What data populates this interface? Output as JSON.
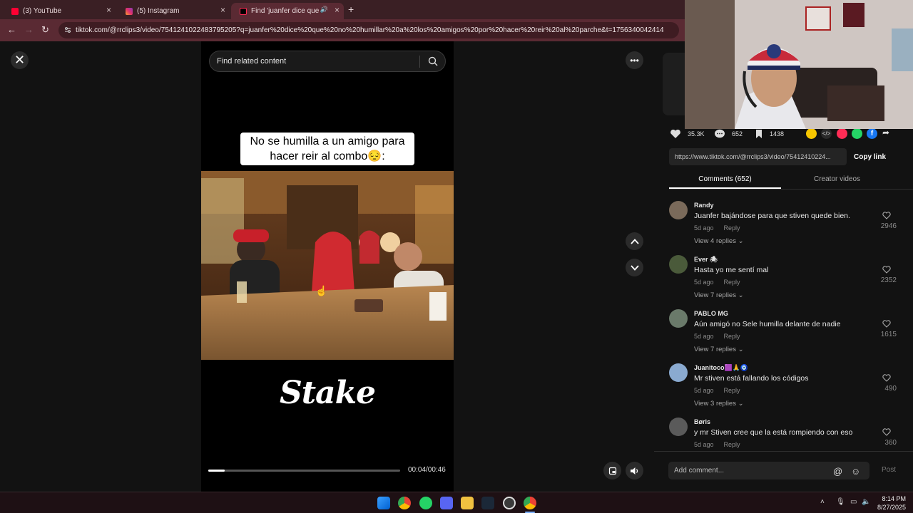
{
  "browser": {
    "tabs": [
      {
        "label": "(3) YouTube",
        "favicon_color": "#ff0033"
      },
      {
        "label": "(5) Instagram",
        "favicon_color": "#e1306c"
      },
      {
        "label": "Find 'juanfer dice que no h",
        "favicon_color": "#000000"
      }
    ],
    "new_tab": "+",
    "url": "tiktok.com/@rrclips3/video/7541241022483795205?q=juanfer%20dice%20que%20no%20humillar%20a%20los%20amigos%20por%20hacer%20reir%20al%20parche&t=1756340042414"
  },
  "video": {
    "search_placeholder": "Find related content",
    "caption": "No se humilla a un amigo para hacer reir al combo😔:",
    "watermark": "Stake",
    "time": "00:04/00:46",
    "progress": 0.087
  },
  "stats": {
    "likes": "35.3K",
    "comments": "652",
    "saves": "1438"
  },
  "share": {
    "link": "https://www.tiktok.com/@rrclips3/video/75412410224...",
    "copy_label": "Copy link"
  },
  "tabs": {
    "comments": "Comments (652)",
    "creator": "Creator videos"
  },
  "comments": [
    {
      "user": "Randy",
      "text": "Juanfer bajándose para que stiven quede bien.",
      "age": "5d ago",
      "reply": "Reply",
      "replies": "View 4 replies ⌄",
      "likes": "2946",
      "avatar_color": "#7a6a5a"
    },
    {
      "user": "Ever 🕷",
      "text": "Hasta yo me sentí mal",
      "age": "5d ago",
      "reply": "Reply",
      "replies": "View 7 replies ⌄",
      "likes": "2352",
      "avatar_color": "#4a5a3a"
    },
    {
      "user": "PABLO MG",
      "text": "Aún amigó no Sele humilla delante de nadie",
      "age": "5d ago",
      "reply": "Reply",
      "replies": "View 7 replies ⌄",
      "likes": "1615",
      "avatar_color": "#6a7a6a"
    },
    {
      "user": "Juanitoco🟪🙏🧿",
      "text": "Mr stiven está fallando los códigos",
      "age": "5d ago",
      "reply": "Reply",
      "replies": "View 3 replies ⌄",
      "likes": "490",
      "avatar_color": "#8aaad0"
    },
    {
      "user": "Børis",
      "text": "y mr Stiven cree que la está rompiendo con eso",
      "age": "5d ago",
      "reply": "Reply",
      "replies": "",
      "likes": "360",
      "avatar_color": "#5a5a5a"
    }
  ],
  "composer": {
    "placeholder": "Add comment...",
    "post": "Post"
  },
  "clock": {
    "time": "8:14 PM",
    "date": "8/27/2025"
  },
  "colors": {
    "chrome_tabbar": "#3a1f24",
    "chrome_toolbar": "#5a2a33",
    "tiktok_red": "#fe2c55"
  }
}
